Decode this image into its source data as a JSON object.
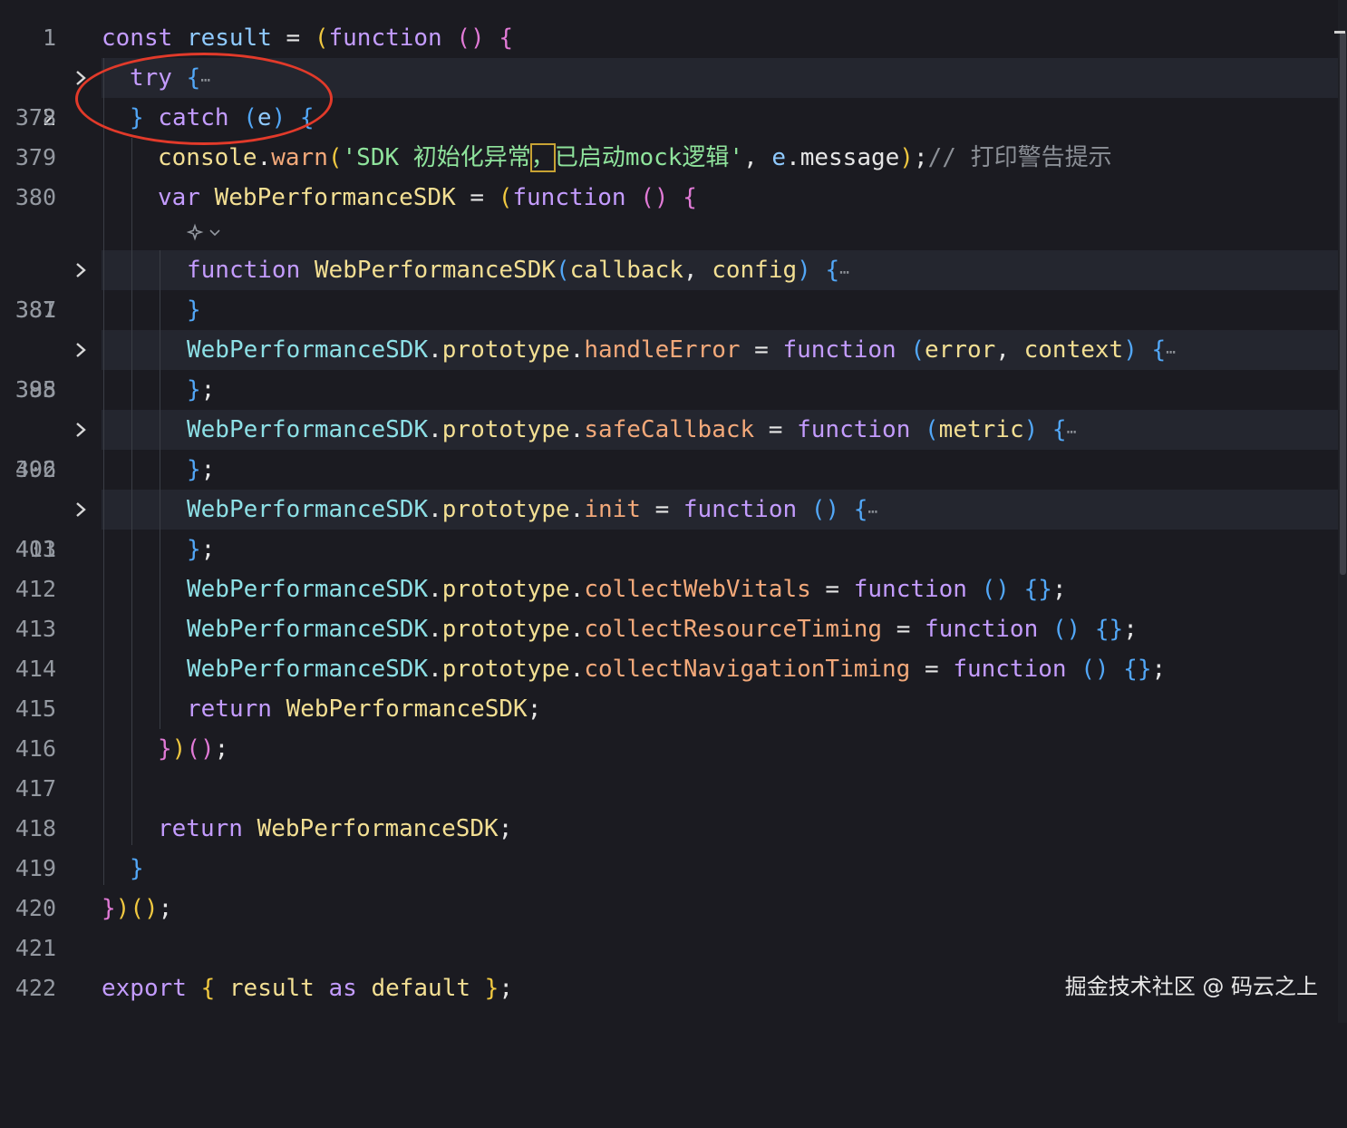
{
  "editor": {
    "lines": [
      {
        "num": "1",
        "tokens": [
          [
            "kw",
            "const"
          ],
          [
            "pl",
            " "
          ],
          [
            "var",
            "result"
          ],
          [
            "pl",
            " = "
          ],
          [
            "b1",
            "("
          ],
          [
            "kw",
            "function"
          ],
          [
            "pl",
            " "
          ],
          [
            "b2",
            "()"
          ],
          [
            "pl",
            " "
          ],
          [
            "b2",
            "{"
          ]
        ]
      },
      {
        "num": "2",
        "folded": true,
        "active": true,
        "tokens": [
          [
            "kw",
            "try"
          ],
          [
            "pl",
            " "
          ],
          [
            "b3",
            "{"
          ]
        ]
      },
      {
        "num": "378",
        "tokens": [
          [
            "b3",
            "}"
          ],
          [
            "pl",
            " "
          ],
          [
            "kw",
            "catch"
          ],
          [
            "pl",
            " "
          ],
          [
            "b3",
            "("
          ],
          [
            "var",
            "e"
          ],
          [
            "b3",
            ")"
          ],
          [
            "pl",
            " "
          ],
          [
            "b3",
            "{"
          ]
        ]
      },
      {
        "num": "379",
        "tokens": [
          [
            "fn",
            "console"
          ],
          [
            "pl",
            "."
          ],
          [
            "prop",
            "warn"
          ],
          [
            "b1",
            "("
          ],
          [
            "str",
            "'SDK 初始化异常"
          ],
          [
            "str",
            "，"
          ],
          [
            "str",
            "已启动mock逻辑'"
          ],
          [
            "pl",
            ", "
          ],
          [
            "var",
            "e"
          ],
          [
            "pl",
            "."
          ],
          [
            "pl",
            "message"
          ],
          [
            "b1",
            ")"
          ],
          [
            "pl",
            ";"
          ],
          [
            "cm",
            "// 打印警告提示"
          ]
        ]
      },
      {
        "num": "380",
        "tokens": [
          [
            "kw",
            "var"
          ],
          [
            "pl",
            " "
          ],
          [
            "fn",
            "WebPerformanceSDK"
          ],
          [
            "pl",
            " = "
          ],
          [
            "b1",
            "("
          ],
          [
            "kw",
            "function"
          ],
          [
            "pl",
            " "
          ],
          [
            "b2",
            "()"
          ],
          [
            "pl",
            " "
          ],
          [
            "b2",
            "{"
          ]
        ]
      },
      {
        "num": "381",
        "folded": true,
        "tokens": [
          [
            "kw",
            "function"
          ],
          [
            "pl",
            " "
          ],
          [
            "fn",
            "WebPerformanceSDK"
          ],
          [
            "b3",
            "("
          ],
          [
            "fn",
            "callback"
          ],
          [
            "pl",
            ", "
          ],
          [
            "fn",
            "config"
          ],
          [
            "b3",
            ")"
          ],
          [
            "pl",
            " "
          ],
          [
            "b3",
            "{"
          ]
        ]
      },
      {
        "num": "387",
        "tokens": [
          [
            "b3",
            "}"
          ]
        ]
      },
      {
        "num": "388",
        "folded": true,
        "tokens": [
          [
            "cls",
            "WebPerformanceSDK"
          ],
          [
            "pl",
            "."
          ],
          [
            "fn",
            "prototype"
          ],
          [
            "pl",
            "."
          ],
          [
            "prop",
            "handleError"
          ],
          [
            "pl",
            " = "
          ],
          [
            "kw",
            "function"
          ],
          [
            "pl",
            " "
          ],
          [
            "b3",
            "("
          ],
          [
            "fn",
            "error"
          ],
          [
            "pl",
            ", "
          ],
          [
            "fn",
            "context"
          ],
          [
            "b3",
            ")"
          ],
          [
            "pl",
            " "
          ],
          [
            "b3",
            "{"
          ]
        ]
      },
      {
        "num": "395",
        "tokens": [
          [
            "b3",
            "}"
          ],
          [
            "pl",
            ";"
          ]
        ]
      },
      {
        "num": "396",
        "folded": true,
        "tokens": [
          [
            "cls",
            "WebPerformanceSDK"
          ],
          [
            "pl",
            "."
          ],
          [
            "fn",
            "prototype"
          ],
          [
            "pl",
            "."
          ],
          [
            "prop",
            "safeCallback"
          ],
          [
            "pl",
            " = "
          ],
          [
            "kw",
            "function"
          ],
          [
            "pl",
            " "
          ],
          [
            "b3",
            "("
          ],
          [
            "fn",
            "metric"
          ],
          [
            "b3",
            ")"
          ],
          [
            "pl",
            " "
          ],
          [
            "b3",
            "{"
          ]
        ]
      },
      {
        "num": "402",
        "tokens": [
          [
            "b3",
            "}"
          ],
          [
            "pl",
            ";"
          ]
        ]
      },
      {
        "num": "403",
        "folded": true,
        "tokens": [
          [
            "cls",
            "WebPerformanceSDK"
          ],
          [
            "pl",
            "."
          ],
          [
            "fn",
            "prototype"
          ],
          [
            "pl",
            "."
          ],
          [
            "prop",
            "init"
          ],
          [
            "pl",
            " = "
          ],
          [
            "kw",
            "function"
          ],
          [
            "pl",
            " "
          ],
          [
            "b3",
            "()"
          ],
          [
            "pl",
            " "
          ],
          [
            "b3",
            "{"
          ]
        ]
      },
      {
        "num": "411",
        "tokens": [
          [
            "b3",
            "}"
          ],
          [
            "pl",
            ";"
          ]
        ]
      },
      {
        "num": "412",
        "tokens": [
          [
            "cls",
            "WebPerformanceSDK"
          ],
          [
            "pl",
            "."
          ],
          [
            "fn",
            "prototype"
          ],
          [
            "pl",
            "."
          ],
          [
            "prop",
            "collectWebVitals"
          ],
          [
            "pl",
            " = "
          ],
          [
            "kw",
            "function"
          ],
          [
            "pl",
            " "
          ],
          [
            "b3",
            "()"
          ],
          [
            "pl",
            " "
          ],
          [
            "b3",
            "{}"
          ],
          [
            "pl",
            ";"
          ]
        ]
      },
      {
        "num": "413",
        "tokens": [
          [
            "cls",
            "WebPerformanceSDK"
          ],
          [
            "pl",
            "."
          ],
          [
            "fn",
            "prototype"
          ],
          [
            "pl",
            "."
          ],
          [
            "prop",
            "collectResourceTiming"
          ],
          [
            "pl",
            " = "
          ],
          [
            "kw",
            "function"
          ],
          [
            "pl",
            " "
          ],
          [
            "b3",
            "()"
          ],
          [
            "pl",
            " "
          ],
          [
            "b3",
            "{}"
          ],
          [
            "pl",
            ";"
          ]
        ]
      },
      {
        "num": "414",
        "tokens": [
          [
            "cls",
            "WebPerformanceSDK"
          ],
          [
            "pl",
            "."
          ],
          [
            "fn",
            "prototype"
          ],
          [
            "pl",
            "."
          ],
          [
            "prop",
            "collectNavigationTiming"
          ],
          [
            "pl",
            " = "
          ],
          [
            "kw",
            "function"
          ],
          [
            "pl",
            " "
          ],
          [
            "b3",
            "()"
          ],
          [
            "pl",
            " "
          ],
          [
            "b3",
            "{}"
          ],
          [
            "pl",
            ";"
          ]
        ]
      },
      {
        "num": "415",
        "tokens": [
          [
            "kw",
            "return"
          ],
          [
            "pl",
            " "
          ],
          [
            "fn",
            "WebPerformanceSDK"
          ],
          [
            "pl",
            ";"
          ]
        ]
      },
      {
        "num": "416",
        "tokens": [
          [
            "b2",
            "}"
          ],
          [
            "b1",
            ")"
          ],
          [
            "b2",
            "()"
          ],
          [
            "pl",
            ";"
          ]
        ]
      },
      {
        "num": "417",
        "tokens": []
      },
      {
        "num": "418",
        "tokens": [
          [
            "kw",
            "return"
          ],
          [
            "pl",
            " "
          ],
          [
            "fn",
            "WebPerformanceSDK"
          ],
          [
            "pl",
            ";"
          ]
        ]
      },
      {
        "num": "419",
        "tokens": [
          [
            "b3",
            "}"
          ]
        ]
      },
      {
        "num": "420",
        "tokens": [
          [
            "b2",
            "}"
          ],
          [
            "b1",
            ")"
          ],
          [
            "b1",
            "()"
          ],
          [
            "pl",
            ";"
          ]
        ]
      },
      {
        "num": "421",
        "tokens": []
      },
      {
        "num": "422",
        "tokens": [
          [
            "kw",
            "export"
          ],
          [
            "pl",
            " "
          ],
          [
            "b1",
            "{"
          ],
          [
            "pl",
            " "
          ],
          [
            "fn",
            "result"
          ],
          [
            "pl",
            " "
          ],
          [
            "kw",
            "as"
          ],
          [
            "pl",
            " "
          ],
          [
            "fn",
            "default"
          ],
          [
            "pl",
            " "
          ],
          [
            "b1",
            "}"
          ],
          [
            "pl",
            ";"
          ]
        ]
      }
    ],
    "fold_ellipsis": "⋯"
  },
  "watermark": "掘金技术社区 @ 码云之上",
  "colors": {
    "background": "#1b1b21",
    "annotation_circle": "#e23a2a",
    "keyword": "#c49cff",
    "function": "#f3df93",
    "string": "#8fe39c",
    "property": "#f3a97a"
  },
  "icons": {
    "fold": "chevron-right-icon",
    "ai_hint": "sparkle-icon"
  }
}
